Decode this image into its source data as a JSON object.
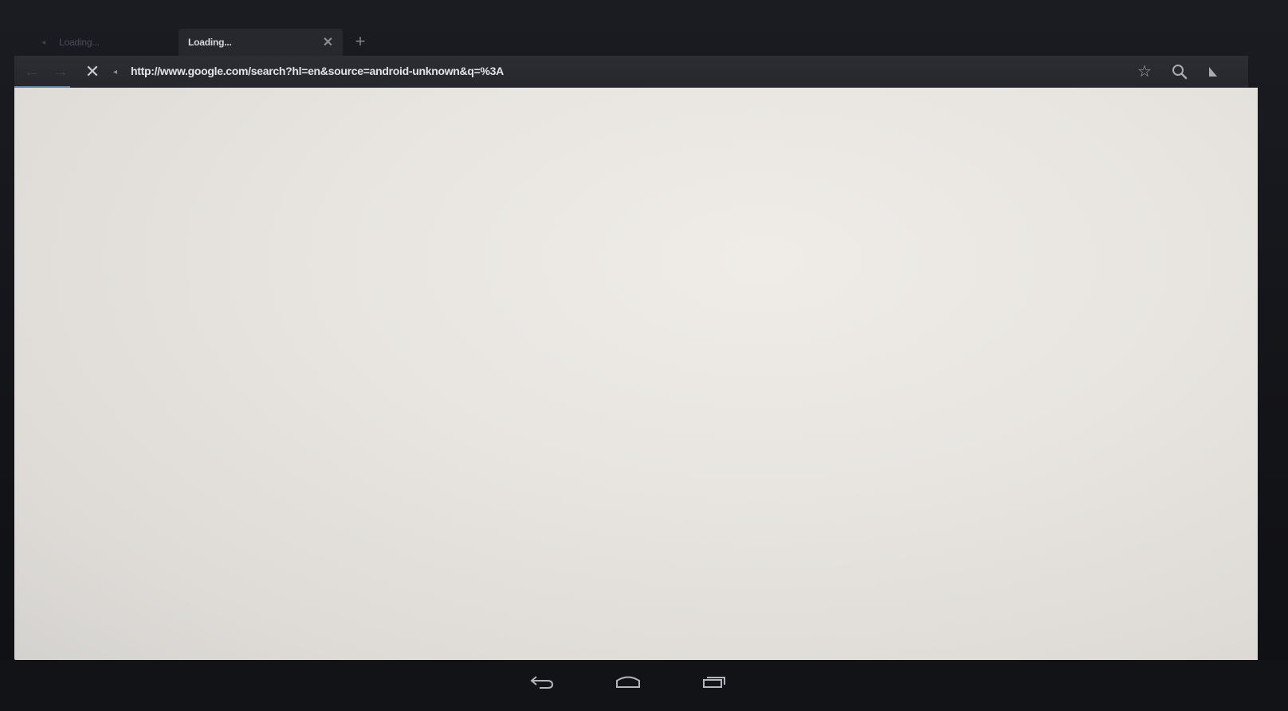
{
  "tabs": [
    {
      "title": "Loading...",
      "active": false
    },
    {
      "title": "Loading...",
      "active": true
    }
  ],
  "toolbar": {
    "url": "http://www.google.com/search?hl=en&source=android-unknown&q=%3A"
  },
  "icons": {
    "back": "back-arrow-icon",
    "forward": "forward-arrow-icon",
    "stop": "stop-icon",
    "site": "site-info-icon",
    "star": "star-icon",
    "search": "search-icon",
    "menu": "menu-icon",
    "close": "close-icon",
    "new_tab": "plus-icon",
    "nav_back": "nav-back-icon",
    "nav_home": "nav-home-icon",
    "nav_recent": "nav-recent-apps-icon"
  },
  "colors": {
    "background": "#141519",
    "toolbar": "#2a2c31",
    "content": "#e8e5e1",
    "accent": "#5b7fa5"
  }
}
